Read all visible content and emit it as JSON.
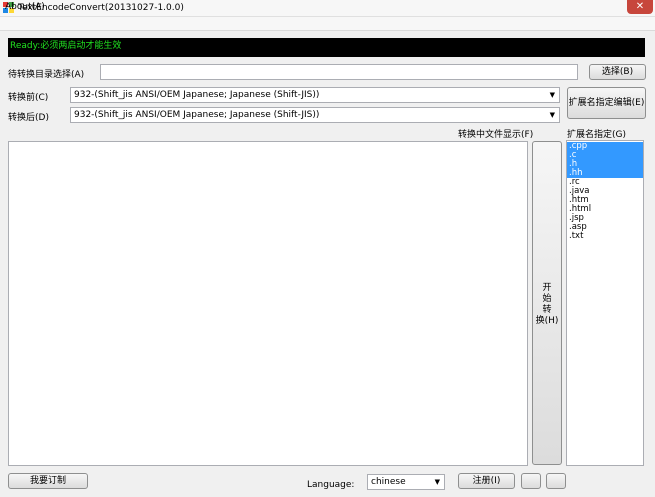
{
  "window": {
    "title": "TextEncodeConvert(20131027-1.0.0)",
    "close_label": "✕"
  },
  "menu": {
    "about": "About(A)"
  },
  "status": {
    "text": "Ready:必须两启动才能生效"
  },
  "source_dir": {
    "label": "待转换目录选择(A)",
    "value": "",
    "browse_label": "选择(B)"
  },
  "encoding_before": {
    "label": "转换前(C)",
    "value": "932-(Shift_jis ANSI/OEM Japanese; Japanese (Shift-JIS))"
  },
  "encoding_after": {
    "label": "转换后(D)",
    "value": "932-(Shift_jis ANSI/OEM Japanese; Japanese (Shift-JIS))"
  },
  "ext_edit": {
    "label": "扩展名指定编辑(E)"
  },
  "file_display": {
    "label": "转换中文件显示(F)"
  },
  "ext_list": {
    "label": "扩展名指定(G)",
    "items": [
      {
        "text": ".cpp",
        "selected": true
      },
      {
        "text": ".c",
        "selected": true
      },
      {
        "text": ".h",
        "selected": true
      },
      {
        "text": ".hh",
        "selected": true
      },
      {
        "text": ".rc",
        "selected": false
      },
      {
        "text": ".java",
        "selected": false
      },
      {
        "text": ".htm",
        "selected": false
      },
      {
        "text": ".html",
        "selected": false
      },
      {
        "text": ".jsp",
        "selected": false
      },
      {
        "text": ".asp",
        "selected": false
      },
      {
        "text": ".txt",
        "selected": false
      }
    ]
  },
  "start_button": {
    "lines": [
      "开",
      "始",
      "转",
      "换(H)"
    ]
  },
  "footer": {
    "order_label": "我要订制",
    "language_label": "Language:",
    "language_value": "chinese",
    "register_label": "注册(I)"
  },
  "colors": {
    "status_bg": "#000000",
    "status_text": "#21e020",
    "selection": "#3399ff",
    "close": "#c7463c"
  }
}
